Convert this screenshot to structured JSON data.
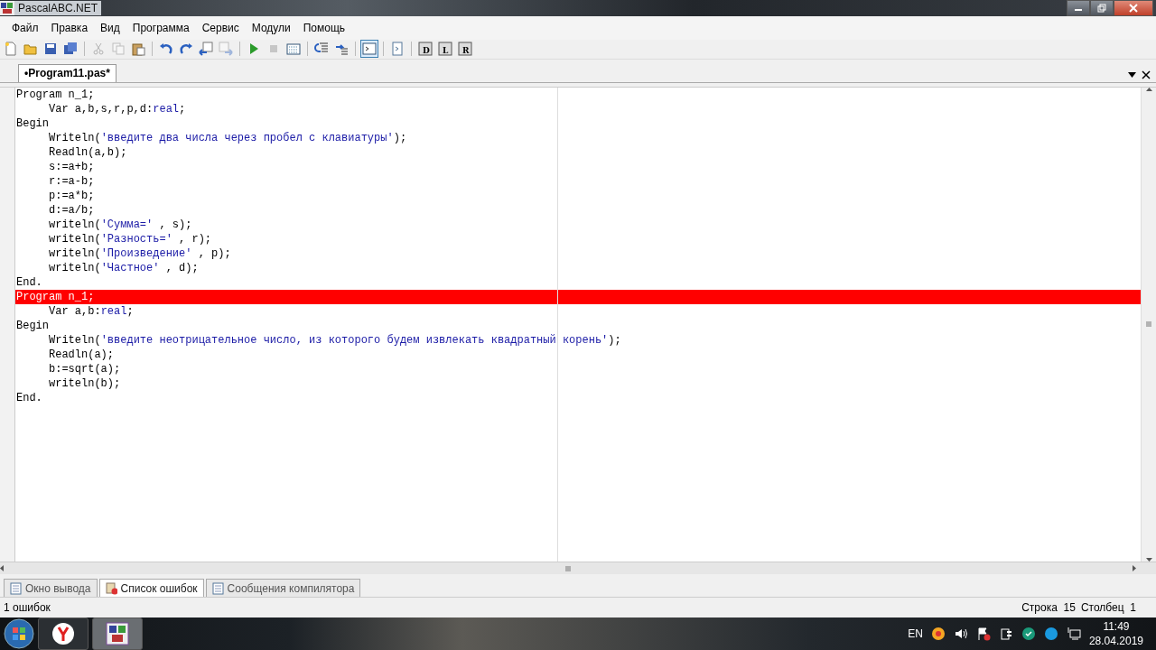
{
  "window": {
    "title": "PascalABC.NET"
  },
  "menu": [
    {
      "label": "Файл"
    },
    {
      "label": "Правка"
    },
    {
      "label": "Вид"
    },
    {
      "label": "Программа"
    },
    {
      "label": "Сервис"
    },
    {
      "label": "Модули"
    },
    {
      "label": "Помощь"
    }
  ],
  "toolbar": [
    {
      "kind": "new",
      "pressed": false,
      "disabled": false
    },
    {
      "kind": "open",
      "pressed": false,
      "disabled": false
    },
    {
      "kind": "save",
      "pressed": false,
      "disabled": false
    },
    {
      "kind": "saveall",
      "pressed": false,
      "disabled": false
    },
    {
      "kind": "sep"
    },
    {
      "kind": "cut",
      "pressed": false,
      "disabled": true
    },
    {
      "kind": "copy",
      "pressed": false,
      "disabled": true
    },
    {
      "kind": "paste",
      "pressed": false,
      "disabled": false
    },
    {
      "kind": "sep"
    },
    {
      "kind": "undo",
      "pressed": false,
      "disabled": false
    },
    {
      "kind": "redo",
      "pressed": false,
      "disabled": false
    },
    {
      "kind": "find",
      "pressed": false,
      "disabled": false
    },
    {
      "kind": "replace",
      "pressed": false,
      "disabled": true
    },
    {
      "kind": "sep"
    },
    {
      "kind": "run",
      "pressed": false,
      "disabled": false
    },
    {
      "kind": "stop",
      "pressed": false,
      "disabled": true
    },
    {
      "kind": "compile",
      "pressed": false,
      "disabled": false
    },
    {
      "kind": "sep"
    },
    {
      "kind": "stepinto",
      "pressed": false,
      "disabled": false
    },
    {
      "kind": "stepover",
      "pressed": false,
      "disabled": false
    },
    {
      "kind": "sep"
    },
    {
      "kind": "console",
      "pressed": true,
      "disabled": false
    },
    {
      "kind": "sep"
    },
    {
      "kind": "page",
      "pressed": false,
      "disabled": false
    },
    {
      "kind": "sep"
    },
    {
      "kind": "form",
      "letter": "D",
      "pressed": false,
      "disabled": false
    },
    {
      "kind": "form",
      "letter": "L",
      "pressed": false,
      "disabled": false
    },
    {
      "kind": "form",
      "letter": "R",
      "pressed": false,
      "disabled": false
    }
  ],
  "document_tabs": [
    {
      "label": "•Program11.pas*",
      "selected": true
    }
  ],
  "editor": {
    "lines": [
      {
        "error": false,
        "segments": [
          {
            "kind": "plain",
            "text": "Program n_1;"
          }
        ]
      },
      {
        "error": false,
        "segments": [
          {
            "kind": "plain",
            "text": "     Var a,b,s,r,p,d:"
          },
          {
            "kind": "type",
            "text": "real"
          },
          {
            "kind": "plain",
            "text": ";"
          }
        ]
      },
      {
        "error": false,
        "segments": [
          {
            "kind": "plain",
            "text": "Begin"
          }
        ]
      },
      {
        "error": false,
        "segments": [
          {
            "kind": "plain",
            "text": "     Writeln("
          },
          {
            "kind": "string",
            "text": "'введите два числа через пробел с клавиатуры'"
          },
          {
            "kind": "plain",
            "text": ");"
          }
        ]
      },
      {
        "error": false,
        "segments": [
          {
            "kind": "plain",
            "text": "     Readln(a,b);"
          }
        ]
      },
      {
        "error": false,
        "segments": [
          {
            "kind": "plain",
            "text": "     s:=a+b;"
          }
        ]
      },
      {
        "error": false,
        "segments": [
          {
            "kind": "plain",
            "text": "     r:=a-b;"
          }
        ]
      },
      {
        "error": false,
        "segments": [
          {
            "kind": "plain",
            "text": "     p:=a*b;"
          }
        ]
      },
      {
        "error": false,
        "segments": [
          {
            "kind": "plain",
            "text": "     d:=a/b;"
          }
        ]
      },
      {
        "error": false,
        "segments": [
          {
            "kind": "plain",
            "text": "     writeln("
          },
          {
            "kind": "string",
            "text": "'Сумма='"
          },
          {
            "kind": "plain",
            "text": " , s);"
          }
        ]
      },
      {
        "error": false,
        "segments": [
          {
            "kind": "plain",
            "text": "     writeln("
          },
          {
            "kind": "string",
            "text": "'Разность='"
          },
          {
            "kind": "plain",
            "text": " , r);"
          }
        ]
      },
      {
        "error": false,
        "segments": [
          {
            "kind": "plain",
            "text": "     writeln("
          },
          {
            "kind": "string",
            "text": "'Произведение'"
          },
          {
            "kind": "plain",
            "text": " , p);"
          }
        ]
      },
      {
        "error": false,
        "segments": [
          {
            "kind": "plain",
            "text": "     writeln("
          },
          {
            "kind": "string",
            "text": "'Частное'"
          },
          {
            "kind": "plain",
            "text": " , d);"
          }
        ]
      },
      {
        "error": false,
        "segments": [
          {
            "kind": "plain",
            "text": "End."
          }
        ]
      },
      {
        "error": true,
        "segments": [
          {
            "kind": "plain",
            "text": "Program n_1;"
          }
        ]
      },
      {
        "error": false,
        "segments": [
          {
            "kind": "plain",
            "text": "     Var a,b:"
          },
          {
            "kind": "type",
            "text": "real"
          },
          {
            "kind": "plain",
            "text": ";"
          }
        ]
      },
      {
        "error": false,
        "segments": [
          {
            "kind": "plain",
            "text": "Begin"
          }
        ]
      },
      {
        "error": false,
        "segments": [
          {
            "kind": "plain",
            "text": "     Writeln("
          },
          {
            "kind": "string",
            "text": "'введите неотрицательное число, из которого будем извлекать квадратный корень'"
          },
          {
            "kind": "plain",
            "text": ");"
          }
        ]
      },
      {
        "error": false,
        "segments": [
          {
            "kind": "plain",
            "text": "     Readln(a);"
          }
        ]
      },
      {
        "error": false,
        "segments": [
          {
            "kind": "plain",
            "text": "     b:=sqrt(a);"
          }
        ]
      },
      {
        "error": false,
        "segments": [
          {
            "kind": "plain",
            "text": "     writeln(b);"
          }
        ]
      },
      {
        "error": false,
        "segments": [
          {
            "kind": "plain",
            "text": "End."
          }
        ]
      }
    ]
  },
  "bottom_tabs": [
    {
      "label": "Окно вывода",
      "kind": "output",
      "selected": false
    },
    {
      "label": "Список ошибок",
      "kind": "errors",
      "selected": true
    },
    {
      "label": "Сообщения компилятора",
      "kind": "messages",
      "selected": false
    }
  ],
  "status_bar": {
    "left": "1 ошибок",
    "row_label": "Строка",
    "row": "15",
    "col_label": "Столбец",
    "col": "1"
  },
  "taskbar": {
    "apps": [
      {
        "kind": "browser",
        "active": false
      },
      {
        "kind": "pascal",
        "active": true
      }
    ],
    "language": "EN",
    "time": "11:49",
    "date": "28.04.2019"
  }
}
